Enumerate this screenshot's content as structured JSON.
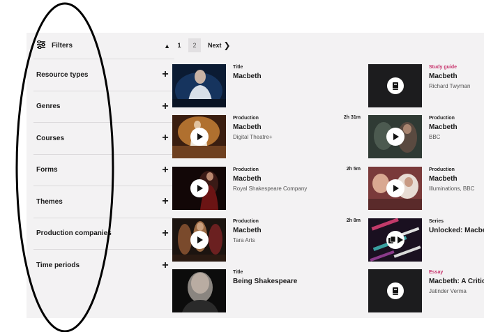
{
  "sidebar": {
    "title": "Filters",
    "facets": [
      {
        "label": "Resource types"
      },
      {
        "label": "Genres"
      },
      {
        "label": "Courses"
      },
      {
        "label": "Forms"
      },
      {
        "label": "Themes"
      },
      {
        "label": "Production companies"
      },
      {
        "label": "Time periods"
      }
    ]
  },
  "pagination": {
    "pages": [
      "1",
      "2"
    ],
    "current": "2",
    "next_label": "Next"
  },
  "results": {
    "left": [
      {
        "type": "Title",
        "title": "Macbeth",
        "subtitle": "",
        "duration": "",
        "kind": "none"
      },
      {
        "type": "Production",
        "title": "Macbeth",
        "subtitle": "Digital Theatre+",
        "duration": "2h 31m",
        "kind": "play"
      },
      {
        "type": "Production",
        "title": "Macbeth",
        "subtitle": "Royal Shakespeare Company",
        "duration": "2h 5m",
        "kind": "play"
      },
      {
        "type": "Production",
        "title": "Macbeth",
        "subtitle": "Tara Arts",
        "duration": "2h 8m",
        "kind": "play"
      },
      {
        "type": "Title",
        "title": "Being Shakespeare",
        "subtitle": "",
        "duration": "",
        "kind": "none"
      }
    ],
    "right": [
      {
        "type": "Study guide",
        "title": "Macbeth",
        "subtitle": "Richard Twyman",
        "kind": "doc"
      },
      {
        "type": "Production",
        "title": "Macbeth",
        "subtitle": "BBC",
        "kind": "play"
      },
      {
        "type": "Production",
        "title": "Macbeth",
        "subtitle": "Illuminations, BBC",
        "kind": "play"
      },
      {
        "type": "Series",
        "title": "Unlocked: Macbeth",
        "subtitle": "",
        "kind": "series"
      },
      {
        "type": "Essay",
        "title": "Macbeth: A Critical",
        "subtitle": "Jatinder Verma",
        "kind": "doc"
      }
    ]
  },
  "colors": {
    "accent_pink": "#c7326b",
    "panel": "#f3f2f3"
  },
  "icons": {
    "filters": "sliders-icon",
    "collapse": "chevron-up-icon",
    "expand": "plus-icon",
    "next": "chevron-right-icon",
    "play": "play-icon",
    "document": "book-icon",
    "series": "stack-icon"
  }
}
